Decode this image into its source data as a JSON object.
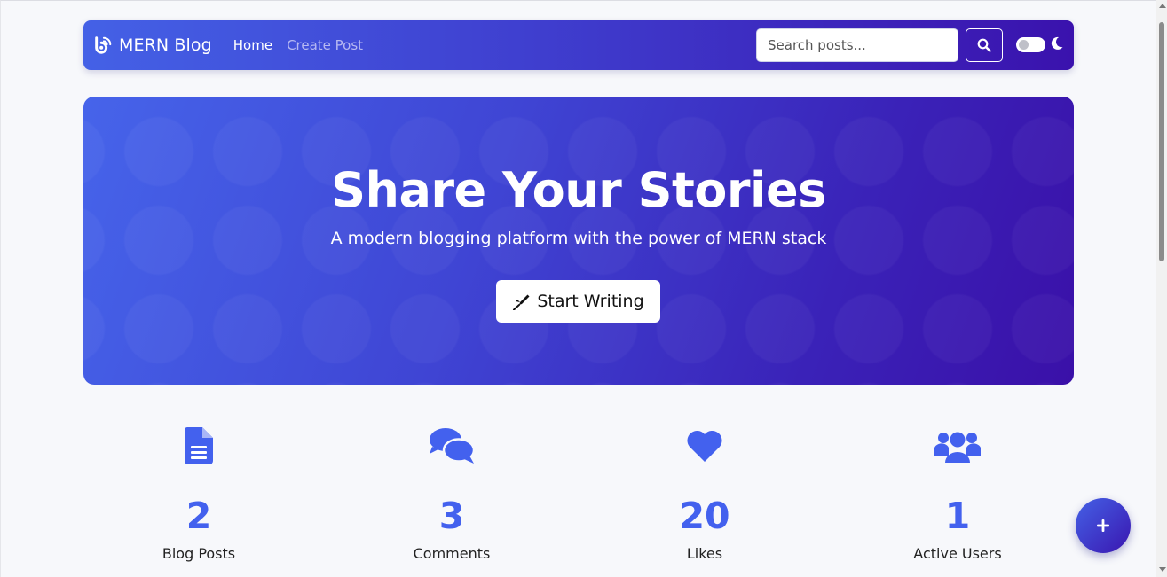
{
  "navbar": {
    "brand": "MERN Blog",
    "links": [
      {
        "label": "Home"
      },
      {
        "label": "Create Post"
      }
    ],
    "search_placeholder": "Search posts..."
  },
  "hero": {
    "title": "Share Your Stories",
    "subtitle": "A modern blogging platform with the power of MERN stack",
    "cta_label": "Start Writing"
  },
  "stats": [
    {
      "icon": "file-alt-icon",
      "value": "2",
      "label": "Blog Posts"
    },
    {
      "icon": "comments-icon",
      "value": "3",
      "label": "Comments"
    },
    {
      "icon": "heart-icon",
      "value": "20",
      "label": "Likes"
    },
    {
      "icon": "users-icon",
      "value": "1",
      "label": "Active Users"
    }
  ],
  "colors": {
    "accent": "#4361ee",
    "gradient_start": "#4461e6",
    "gradient_end": "#3a10a8"
  },
  "fab": {
    "icon": "plus-icon"
  },
  "theme_toggle": {
    "state": "off",
    "icon": "moon-icon"
  }
}
